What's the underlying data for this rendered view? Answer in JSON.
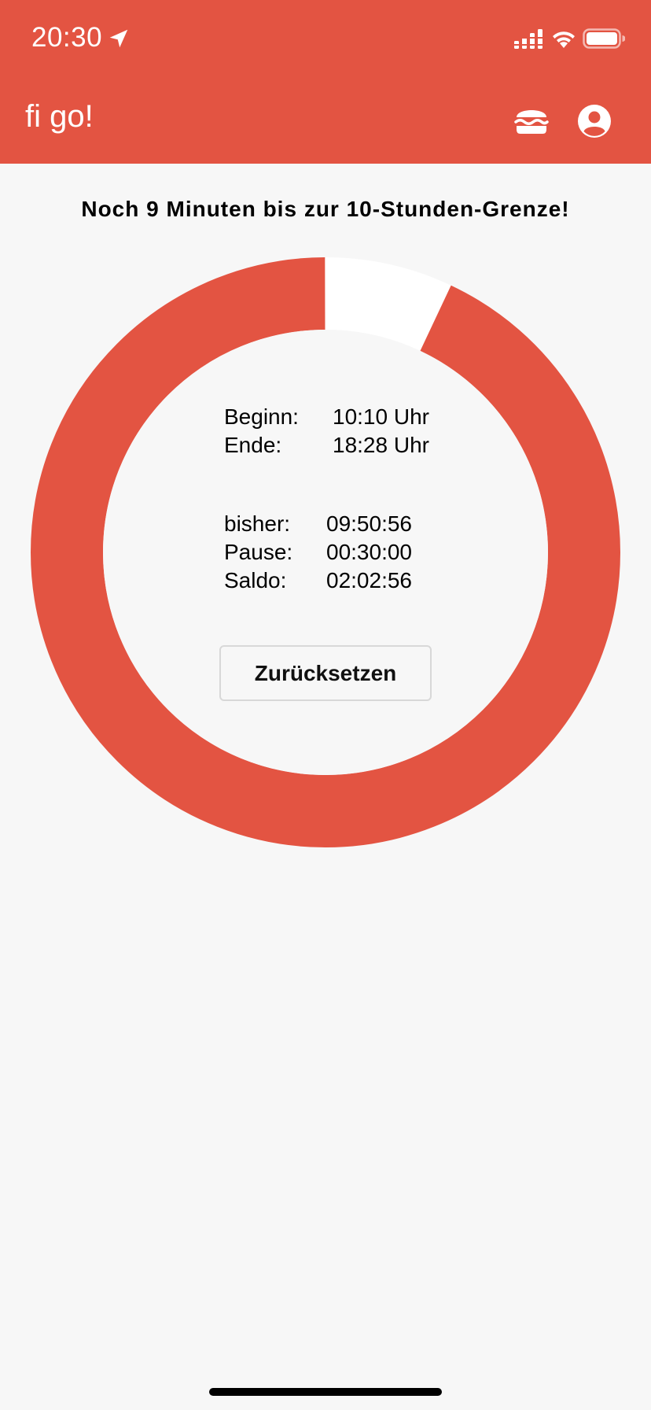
{
  "status_bar": {
    "time": "20:30",
    "icons": [
      "location-arrow-icon",
      "cellular-signal-icon",
      "wifi-icon",
      "battery-icon"
    ]
  },
  "header": {
    "title": "fi go!",
    "actions": [
      {
        "name": "burger-icon"
      },
      {
        "name": "account-circle-icon"
      }
    ],
    "background_color": "#e35442"
  },
  "main": {
    "headline": "Noch 9 Minuten bis zur 10-Stunden-Grenze!",
    "progress": {
      "worked_fraction_of_10h": 0.9844,
      "ring_color": "#e35442",
      "remaining_color": "#ffffff"
    },
    "times": {
      "begin_label": "Beginn:",
      "begin_value": "10:10 Uhr",
      "end_label": "Ende:",
      "end_value": "18:28 Uhr"
    },
    "stats": {
      "so_far_label": "bisher:",
      "so_far_value": "09:50:56",
      "pause_label": "Pause:",
      "pause_value": "00:30:00",
      "balance_label": "Saldo:",
      "balance_value": "02:02:56"
    },
    "reset_button_label": "Zurücksetzen"
  }
}
